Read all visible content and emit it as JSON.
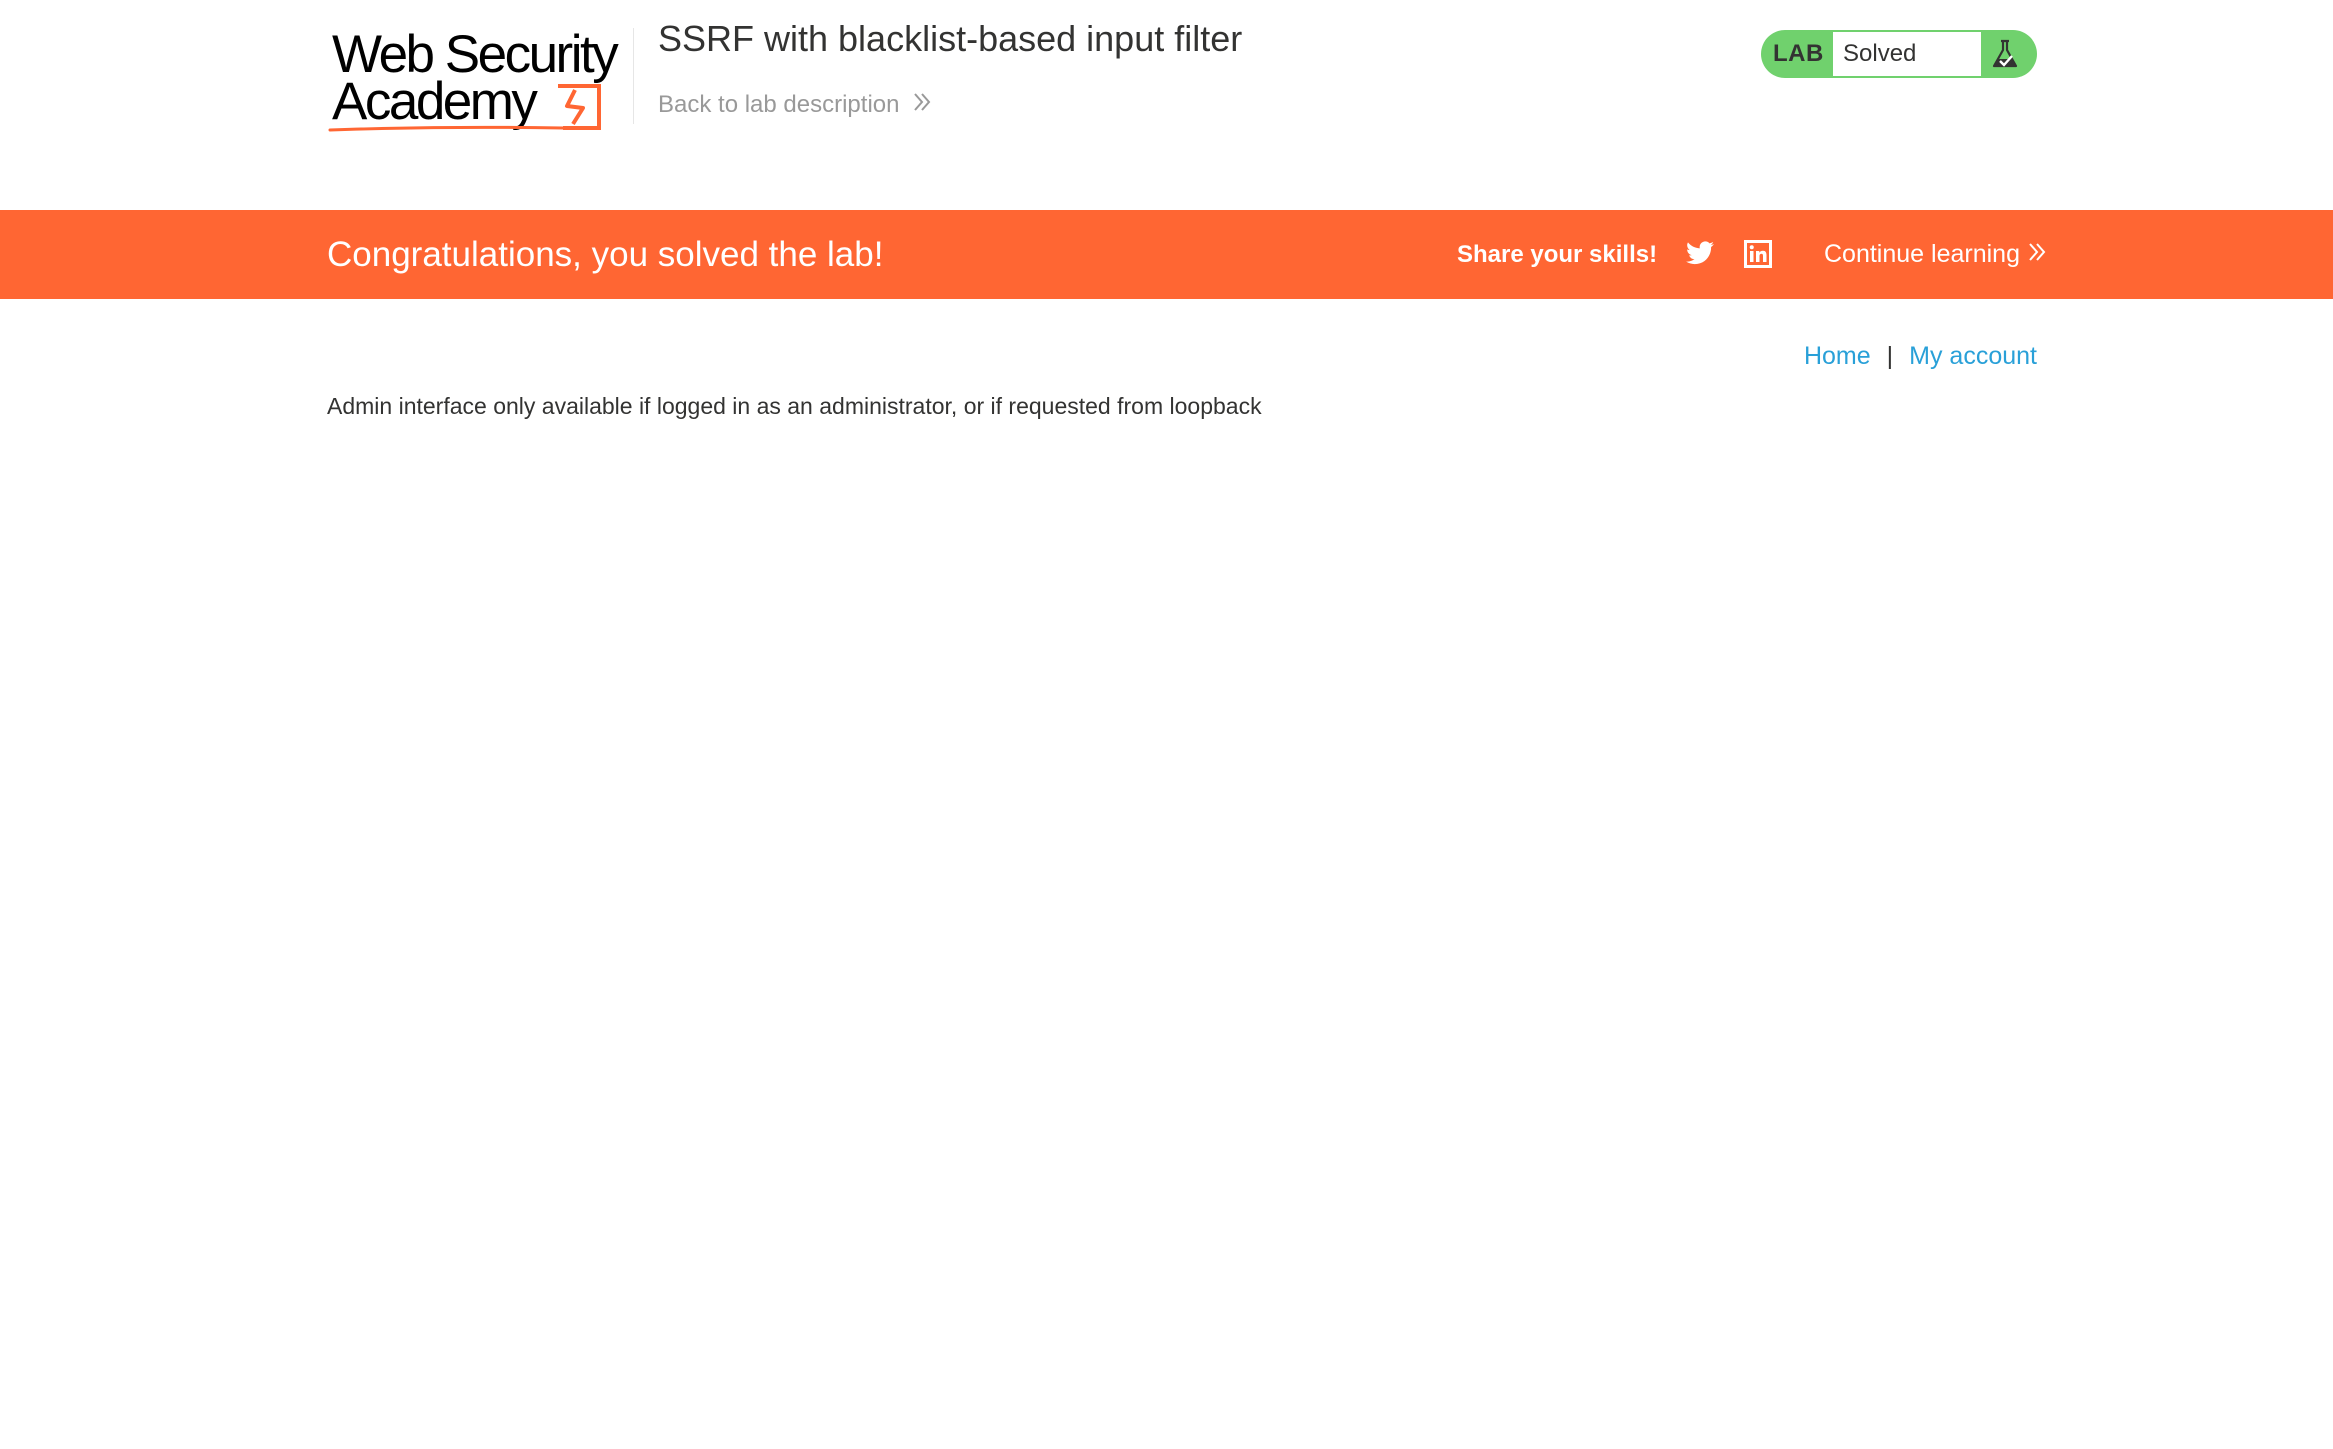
{
  "header": {
    "logo_line1": "Web Security",
    "logo_line2": "Academy",
    "lab_title": "SSRF with blacklist-based input filter",
    "back_link_label": "Back to lab description",
    "lab_badge_label": "LAB",
    "lab_status": "Solved",
    "lab_status_icon": "flask-check-icon"
  },
  "banner": {
    "message": "Congratulations, you solved the lab!",
    "share_label": "Share your skills!",
    "share_icons": [
      "twitter-icon",
      "linkedin-icon"
    ],
    "continue_label": "Continue learning"
  },
  "nav": {
    "home": "Home",
    "separator": "|",
    "my_account": "My account"
  },
  "main": {
    "message": "Admin interface only available if logged in as an administrator, or if requested from loopback"
  },
  "colors": {
    "accent_orange": "#ff6633",
    "status_green": "#70d16d",
    "link_blue": "#29a0d8",
    "text": "#333332"
  }
}
